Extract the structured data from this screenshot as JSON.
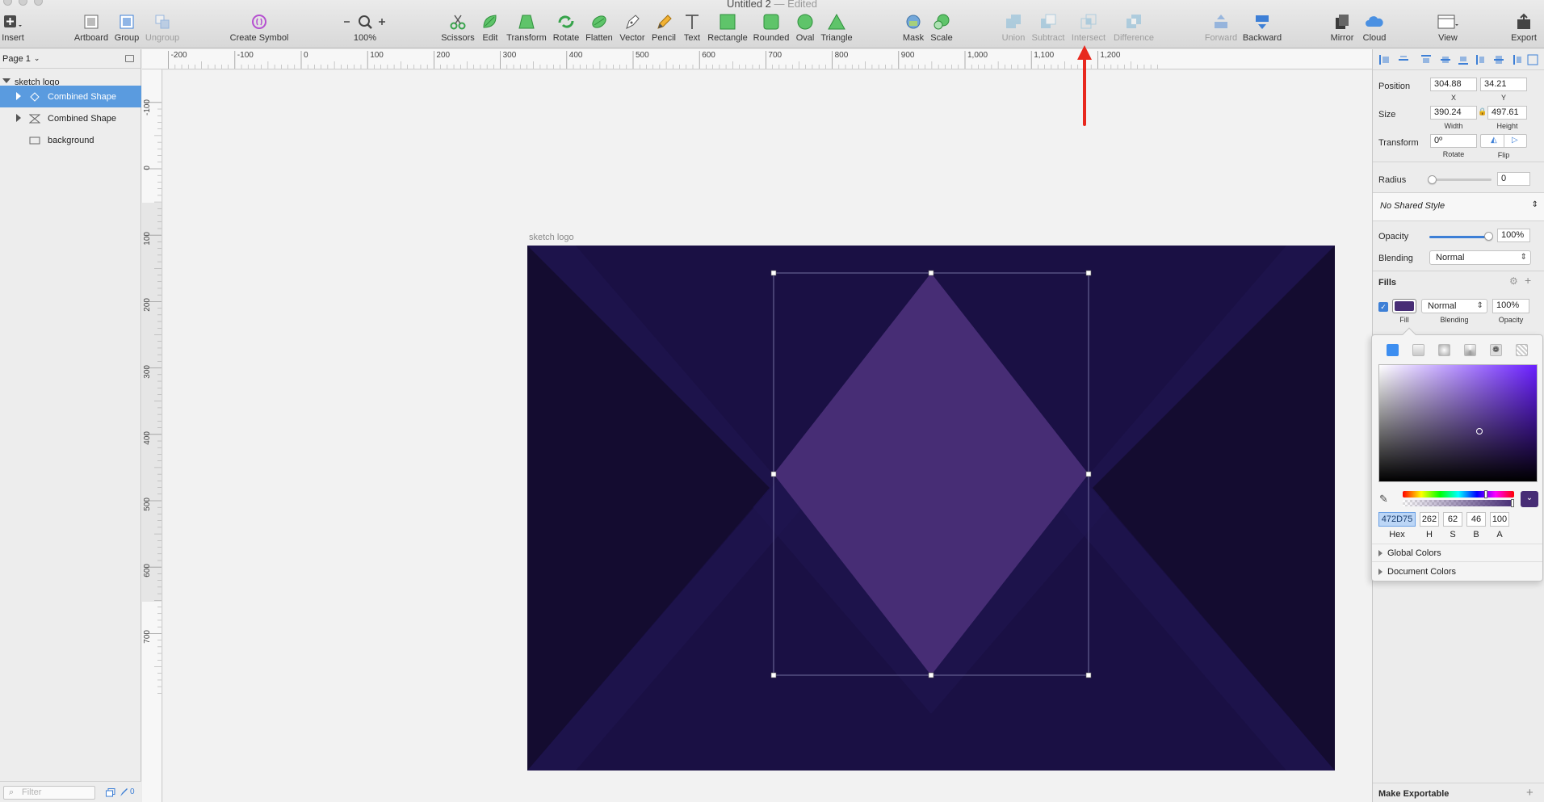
{
  "window": {
    "title": "Untitled 2",
    "edited": "— Edited"
  },
  "toolbar": {
    "items": [
      {
        "id": "insert",
        "label": "Insert",
        "icon": "plus-icon",
        "enabled": true
      },
      {
        "id": "artboard",
        "label": "Artboard",
        "icon": "artboard-icon",
        "enabled": true
      },
      {
        "id": "group",
        "label": "Group",
        "icon": "group-icon",
        "enabled": true
      },
      {
        "id": "ungroup",
        "label": "Ungroup",
        "icon": "ungroup-icon",
        "enabled": false
      },
      {
        "id": "create-symbol",
        "label": "Create Symbol",
        "icon": "symbol-icon",
        "enabled": true
      },
      {
        "id": "zoom",
        "label": "100%",
        "icon": "magnifier-icon",
        "enabled": true
      },
      {
        "id": "scissors",
        "label": "Scissors",
        "icon": "scissors-icon",
        "enabled": true
      },
      {
        "id": "edit",
        "label": "Edit",
        "icon": "edit-icon",
        "enabled": true
      },
      {
        "id": "transform",
        "label": "Transform",
        "icon": "transform-icon",
        "enabled": true
      },
      {
        "id": "rotate",
        "label": "Rotate",
        "icon": "rotate-icon",
        "enabled": true
      },
      {
        "id": "flatten",
        "label": "Flatten",
        "icon": "flatten-icon",
        "enabled": true
      },
      {
        "id": "vector",
        "label": "Vector",
        "icon": "vector-pen-icon",
        "enabled": true
      },
      {
        "id": "pencil",
        "label": "Pencil",
        "icon": "pencil-icon",
        "enabled": true
      },
      {
        "id": "text",
        "label": "Text",
        "icon": "text-icon",
        "enabled": true
      },
      {
        "id": "rectangle",
        "label": "Rectangle",
        "icon": "rectangle-icon",
        "enabled": true
      },
      {
        "id": "rounded",
        "label": "Rounded",
        "icon": "rounded-rect-icon",
        "enabled": true
      },
      {
        "id": "oval",
        "label": "Oval",
        "icon": "oval-icon",
        "enabled": true
      },
      {
        "id": "triangle",
        "label": "Triangle",
        "icon": "triangle-icon",
        "enabled": true
      },
      {
        "id": "mask",
        "label": "Mask",
        "icon": "mask-icon",
        "enabled": true
      },
      {
        "id": "scale",
        "label": "Scale",
        "icon": "scale-icon",
        "enabled": true
      },
      {
        "id": "union",
        "label": "Union",
        "icon": "union-icon",
        "enabled": false
      },
      {
        "id": "subtract",
        "label": "Subtract",
        "icon": "subtract-icon",
        "enabled": false
      },
      {
        "id": "intersect",
        "label": "Intersect",
        "icon": "intersect-icon",
        "enabled": false
      },
      {
        "id": "difference",
        "label": "Difference",
        "icon": "difference-icon",
        "enabled": false
      },
      {
        "id": "forward",
        "label": "Forward",
        "icon": "forward-icon",
        "enabled": false
      },
      {
        "id": "backward",
        "label": "Backward",
        "icon": "backward-icon",
        "enabled": true
      },
      {
        "id": "mirror",
        "label": "Mirror",
        "icon": "mirror-icon",
        "enabled": true
      },
      {
        "id": "cloud",
        "label": "Cloud",
        "icon": "cloud-icon",
        "enabled": true
      },
      {
        "id": "view",
        "label": "View",
        "icon": "view-icon",
        "enabled": true
      },
      {
        "id": "export",
        "label": "Export",
        "icon": "export-icon",
        "enabled": true
      }
    ]
  },
  "layers_panel": {
    "page": "Page 1",
    "layers": [
      {
        "name": "sketch logo",
        "icon": "disclosure-open-icon",
        "selected": false
      },
      {
        "name": "Combined Shape",
        "icon": "diamond-shape-icon",
        "selected": true
      },
      {
        "name": "Combined Shape",
        "icon": "hourglass-shape-icon",
        "selected": false
      },
      {
        "name": "background",
        "icon": "rectangle-layer-icon",
        "selected": false
      }
    ],
    "filter_placeholder": "Filter",
    "page_count": "0"
  },
  "rulers": {
    "horizontal": [
      "-200",
      "-100",
      "0",
      "100",
      "200",
      "300",
      "400",
      "500",
      "600",
      "700",
      "800",
      "900",
      "1,000",
      "1,100",
      "1,200"
    ],
    "vertical": [
      "-100",
      "0",
      "100",
      "200",
      "300",
      "400",
      "500",
      "600",
      "700"
    ]
  },
  "canvas": {
    "artboard_name": "sketch logo",
    "colors": {
      "bg_dark": "#170f35",
      "bg_mid": "#1c1245",
      "diamond": "#472d75"
    }
  },
  "inspector": {
    "position": {
      "label": "Position",
      "x": "304.88",
      "y": "34.21",
      "x_label": "X",
      "y_label": "Y"
    },
    "size": {
      "label": "Size",
      "width": "390.24",
      "height": "497.61",
      "width_label": "Width",
      "height_label": "Height"
    },
    "transform": {
      "label": "Transform",
      "rotate": "0º",
      "rotate_label": "Rotate",
      "flip_label": "Flip"
    },
    "radius": {
      "label": "Radius",
      "value": "0"
    },
    "shared_style": "No Shared Style",
    "opacity": {
      "label": "Opacity",
      "value": "100%",
      "level": 1.0
    },
    "blending": {
      "label": "Blending",
      "value": "Normal"
    },
    "fills": {
      "label": "Fills",
      "fill_color": "#472d75",
      "blending": "Normal",
      "opacity": "100%",
      "fill_label": "Fill",
      "blending_label": "Blending",
      "opacity_label": "Opacity"
    },
    "color_picker": {
      "hex": "472D75",
      "h": "262",
      "s": "62",
      "b": "46",
      "a": "100",
      "hex_label": "Hex",
      "h_label": "H",
      "s_label": "S",
      "b_label": "B",
      "a_label": "A",
      "global_colors": "Global Colors",
      "document_colors": "Document Colors"
    },
    "make_exportable": "Make Exportable"
  }
}
